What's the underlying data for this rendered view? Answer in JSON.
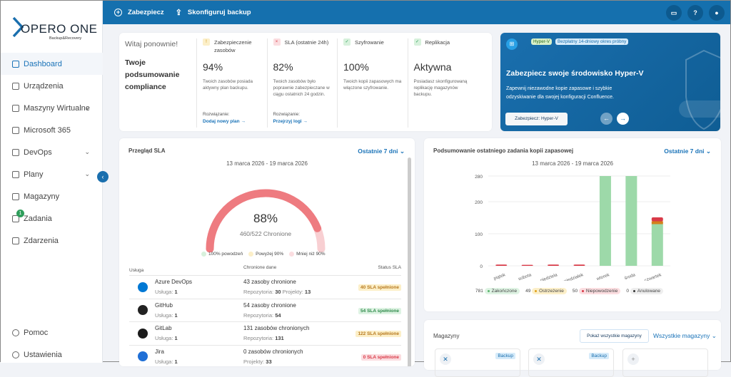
{
  "brand": {
    "name": "OPERO ONE",
    "tagline": "Backup&Recovery"
  },
  "sidebar": {
    "items": [
      {
        "label": "Dashboard",
        "icon": "grid-icon"
      },
      {
        "label": "Urządzenia",
        "icon": "devices-icon"
      },
      {
        "label": "Maszyny Wirtualne",
        "icon": "monitor-icon"
      },
      {
        "label": "Microsoft 365",
        "icon": "office-icon"
      },
      {
        "label": "DevOps",
        "icon": "branch-icon"
      },
      {
        "label": "Plany",
        "icon": "list-icon"
      },
      {
        "label": "Magazyny",
        "icon": "storage-icon"
      },
      {
        "label": "Zadania",
        "icon": "tasks-icon",
        "badge": "1"
      },
      {
        "label": "Zdarzenia",
        "icon": "events-icon"
      }
    ],
    "bottom": [
      {
        "label": "Pomoc"
      },
      {
        "label": "Ustawienia"
      }
    ]
  },
  "topbar": {
    "protect": "Zabezpiecz",
    "configure": "Skonfiguruj backup"
  },
  "compliance": {
    "welcome": "Witaj ponownie!",
    "title": "Twoje podsumowanie compliance",
    "cols": [
      {
        "title": "Zabezpieczenie zasobów",
        "value": "94%",
        "desc": "Twoich zasobów posiada aktywny plan backupu.",
        "solution": "Rozwiązanie:",
        "link": "Dodaj nowy plan →",
        "status": "warning"
      },
      {
        "title": "SLA (ostatnie 24h)",
        "value": "82%",
        "desc": "Twoich zasobów było poprawnie zabezpieczane w ciągu ostatnich 24 godzin.",
        "solution": "Rozwiązanie:",
        "link": "Przejrzyj logi →",
        "status": "error"
      },
      {
        "title": "Szyfrowanie",
        "value": "100%",
        "desc": "Twoich kopii zapasowych ma włączone szyfrowanie.",
        "status": "ok"
      },
      {
        "title": "Replikacja",
        "value": "Aktywna",
        "desc": "Posiadasz skonfigurowaną replikację magazynów backupu.",
        "status": "ok"
      }
    ]
  },
  "promo": {
    "tag1": "Hyper-V",
    "tag2": "Bezpłatny 14-dniowy okres próbny",
    "title": "Zabezpiecz swoje środowisko Hyper-V",
    "desc": "Zapewnij niezawodne kopie zapasowe i szybkie odzyskiwanie dla swojej konfiguracji Confluence.",
    "cta": "Zabezpiecz: Hyper-V"
  },
  "sla": {
    "title": "Przegląd SLA",
    "range": "Ostatnie 7 dni",
    "dates": "13 marca 2026 - 19 marca 2026",
    "percent": "88%",
    "ratio": "460/522 Chronione",
    "fraction": 0.88,
    "legend": [
      "100% powodzeń",
      "Powyżej 90%",
      "Mniej niż 90%"
    ],
    "headers": [
      "Usługa",
      "Chronione dane",
      "Status SLA"
    ],
    "rows": [
      {
        "name": "Azure DevOps",
        "svc_label": "Usługa:",
        "svc": "1",
        "data": "43 zasoby chronione",
        "d1l": "Repozytoria:",
        "d1": "30",
        "d2l": "Projekty:",
        "d2": "13",
        "status": "40 SLA spełnione",
        "level": "warn",
        "color": "#0078d4"
      },
      {
        "name": "GitHub",
        "svc_label": "Usługa:",
        "svc": "1",
        "data": "54 zasoby chronione",
        "d1l": "Repozytoria:",
        "d1": "54",
        "status": "54 SLA spełnione",
        "level": "ok",
        "color": "#222"
      },
      {
        "name": "GitLab",
        "svc_label": "Usługa:",
        "svc": "1",
        "data": "131 zasobów chronionych",
        "d1l": "Repozytoria:",
        "d1": "131",
        "status": "122 SLA spełnione",
        "level": "warn",
        "color": "#1b1b1b"
      },
      {
        "name": "Jira",
        "svc_label": "Usługa:",
        "svc": "1",
        "data": "0 zasobów chronionych",
        "d1l": "Projekty:",
        "d1": "33",
        "status": "0 SLA spełnione",
        "level": "err",
        "color": "#1f6fd6"
      }
    ]
  },
  "backup": {
    "title": "Podsumowanie ostatniego zadania kopii zapasowej",
    "range": "Ostatnie 7 dni",
    "chart_data": {
      "type": "bar",
      "stacked": true,
      "title": "13 marca 2026 - 19 marca 2026",
      "ylim": [
        0,
        280
      ],
      "yticks": [
        0,
        100,
        200,
        280
      ],
      "categories": [
        "piątek",
        "sobota",
        "niedziela",
        "poniedziałek",
        "wtorek",
        "środa",
        "czwartek"
      ],
      "series": [
        {
          "name": "Zakończone",
          "color": "#9dd9a9",
          "values": [
            0,
            0,
            0,
            0,
            280,
            280,
            130
          ]
        },
        {
          "name": "Ostrzeżenie",
          "color": "#d4801c",
          "values": [
            0,
            0,
            0,
            0,
            0,
            0,
            9
          ]
        },
        {
          "name": "Niepowodzenie",
          "color": "#d93a48",
          "values": [
            4,
            3,
            4,
            4,
            0,
            0,
            12
          ]
        },
        {
          "name": "Anulowane",
          "color": "#444",
          "values": [
            0,
            0,
            0,
            0,
            0,
            0,
            0
          ]
        }
      ],
      "totals": [
        {
          "count": "781",
          "label": "Zakończone",
          "bg": "#def3e3",
          "dot": "#5cb56f"
        },
        {
          "count": "49",
          "label": "Ostrzeżenie",
          "bg": "#fcefc8",
          "dot": "#e0a21c"
        },
        {
          "count": "50",
          "label": "Niepowodzenie",
          "bg": "#fbdde0",
          "dot": "#d93a48"
        },
        {
          "count": "0",
          "label": "Anulowane",
          "bg": "#eee",
          "dot": "#333"
        }
      ]
    }
  },
  "storage": {
    "title": "Magazyny",
    "show_all": "Pokaż wszystkie magazyny",
    "filter": "Wszystkie magazyny",
    "tag": "Backup"
  }
}
